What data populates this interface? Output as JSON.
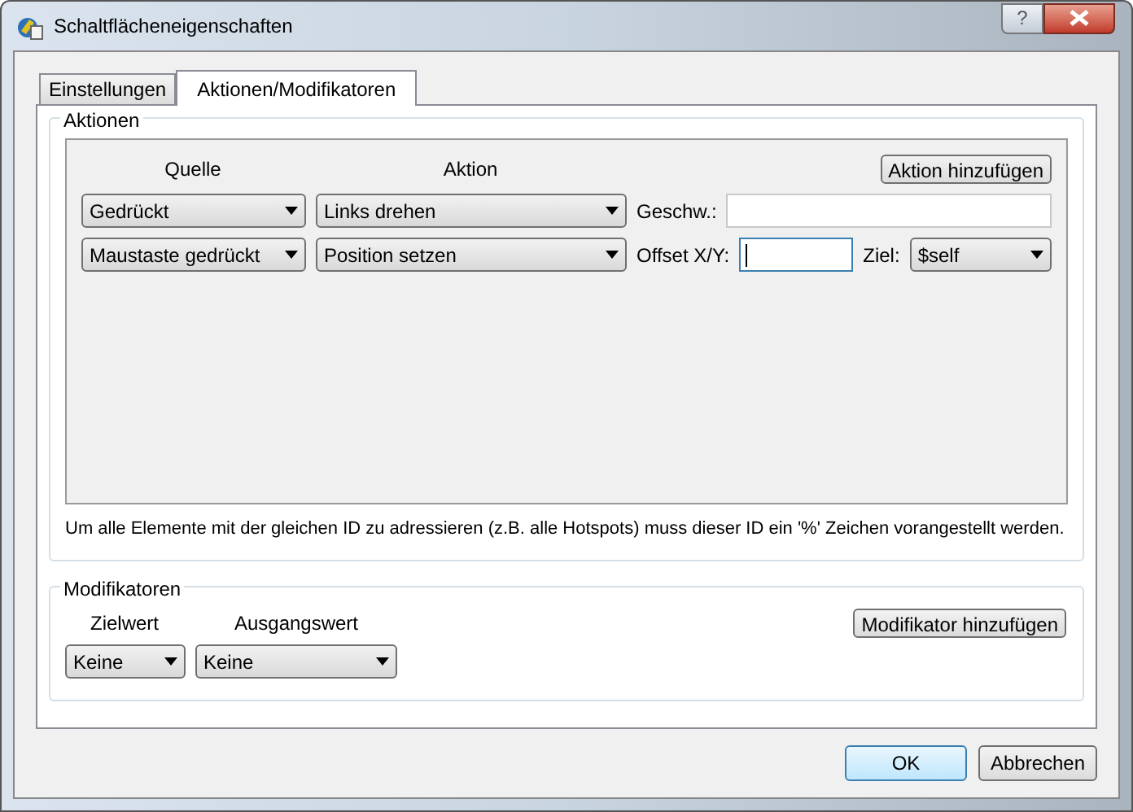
{
  "window": {
    "title": "Schaltflächeneigenschaften",
    "help_button": "?"
  },
  "tabs": [
    {
      "label": "Einstellungen",
      "selected": false
    },
    {
      "label": "Aktionen/Modifikatoren",
      "selected": true
    }
  ],
  "actions": {
    "title": "Aktionen",
    "columns": [
      "Quelle",
      "Aktion"
    ],
    "add_button": "Aktion hinzufügen",
    "rows": [
      {
        "kind": "speed",
        "source": "Gedrückt",
        "action": "Links drehen",
        "param_label": "Geschw.:",
        "param_focused": false
      },
      {
        "kind": "offset",
        "source": "Maustaste gedrückt",
        "action": "Position setzen",
        "param_label": "Offset X/Y:",
        "param_focused": true,
        "target_label": "Ziel:",
        "target": "$self"
      }
    ],
    "note": "Um alle Elemente mit der gleichen ID zu adressieren (z.B. alle Hotspots) muss dieser ID ein '%' Zeichen vorangestellt werden."
  },
  "modifiers": {
    "title": "Modifikatoren",
    "columns": [
      "Zielwert",
      "Ausgangswert"
    ],
    "add_button": "Modifikator hinzufügen",
    "selects": [
      "Keine",
      "Keine"
    ]
  },
  "buttons": [
    {
      "label": "OK",
      "default": true
    },
    {
      "label": "Abbrechen",
      "default": false
    }
  ]
}
